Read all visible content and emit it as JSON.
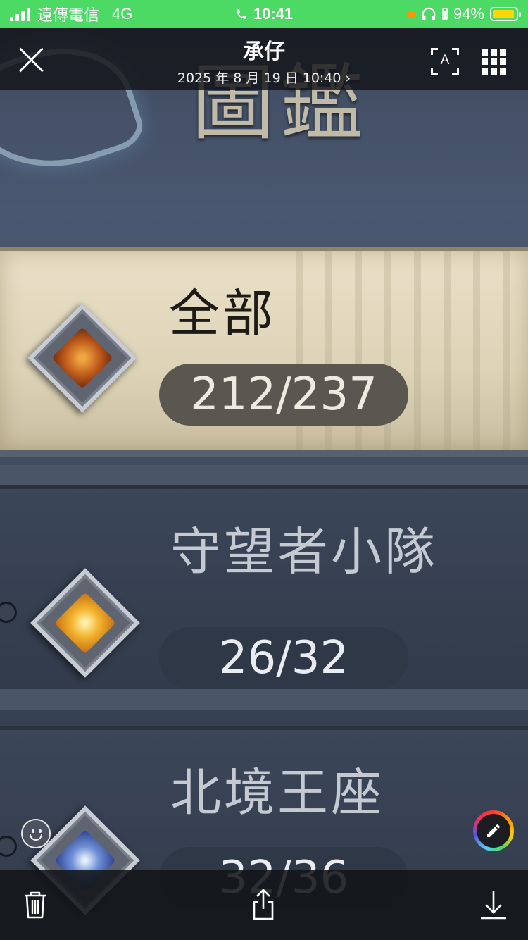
{
  "status_bar": {
    "carrier": "遠傳電信",
    "network": "4G",
    "time": "10:41",
    "battery_percent": "94%",
    "battery_level": 0.94,
    "accent_color": "#4cd964"
  },
  "viewer": {
    "title": "承仔",
    "subtitle": "2025 年 8 月 19 日 10:40 ›",
    "text_scan_letter": "A"
  },
  "photo": {
    "header_text": "圖鑑",
    "rows": [
      {
        "name": "全部",
        "count": "212/237",
        "emblem": "amber-gem-icon",
        "selected": true
      },
      {
        "name": "守望者小隊",
        "count": "26/32",
        "emblem": "gold-flower-icon",
        "selected": false
      },
      {
        "name": "北境王座",
        "count": "32/36",
        "emblem": "blue-trident-icon",
        "selected": false
      }
    ]
  },
  "toolbar": {
    "icons": [
      "trash-icon",
      "share-icon",
      "download-icon"
    ]
  }
}
